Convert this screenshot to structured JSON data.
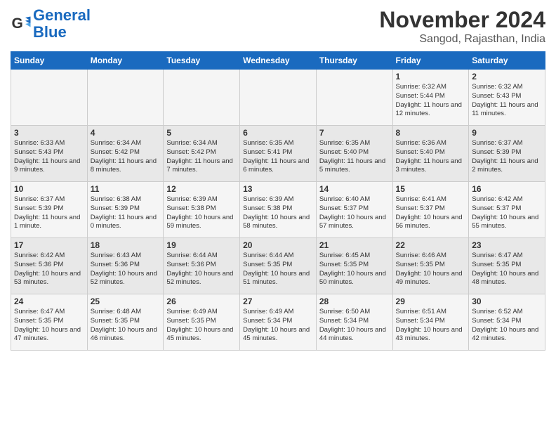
{
  "logo": {
    "line1": "General",
    "line2": "Blue"
  },
  "title": "November 2024",
  "subtitle": "Sangod, Rajasthan, India",
  "weekdays": [
    "Sunday",
    "Monday",
    "Tuesday",
    "Wednesday",
    "Thursday",
    "Friday",
    "Saturday"
  ],
  "weeks": [
    [
      {
        "day": "",
        "info": ""
      },
      {
        "day": "",
        "info": ""
      },
      {
        "day": "",
        "info": ""
      },
      {
        "day": "",
        "info": ""
      },
      {
        "day": "",
        "info": ""
      },
      {
        "day": "1",
        "info": "Sunrise: 6:32 AM\nSunset: 5:44 PM\nDaylight: 11 hours and 12 minutes."
      },
      {
        "day": "2",
        "info": "Sunrise: 6:32 AM\nSunset: 5:43 PM\nDaylight: 11 hours and 11 minutes."
      }
    ],
    [
      {
        "day": "3",
        "info": "Sunrise: 6:33 AM\nSunset: 5:43 PM\nDaylight: 11 hours and 9 minutes."
      },
      {
        "day": "4",
        "info": "Sunrise: 6:34 AM\nSunset: 5:42 PM\nDaylight: 11 hours and 8 minutes."
      },
      {
        "day": "5",
        "info": "Sunrise: 6:34 AM\nSunset: 5:42 PM\nDaylight: 11 hours and 7 minutes."
      },
      {
        "day": "6",
        "info": "Sunrise: 6:35 AM\nSunset: 5:41 PM\nDaylight: 11 hours and 6 minutes."
      },
      {
        "day": "7",
        "info": "Sunrise: 6:35 AM\nSunset: 5:40 PM\nDaylight: 11 hours and 5 minutes."
      },
      {
        "day": "8",
        "info": "Sunrise: 6:36 AM\nSunset: 5:40 PM\nDaylight: 11 hours and 3 minutes."
      },
      {
        "day": "9",
        "info": "Sunrise: 6:37 AM\nSunset: 5:39 PM\nDaylight: 11 hours and 2 minutes."
      }
    ],
    [
      {
        "day": "10",
        "info": "Sunrise: 6:37 AM\nSunset: 5:39 PM\nDaylight: 11 hours and 1 minute."
      },
      {
        "day": "11",
        "info": "Sunrise: 6:38 AM\nSunset: 5:39 PM\nDaylight: 11 hours and 0 minutes."
      },
      {
        "day": "12",
        "info": "Sunrise: 6:39 AM\nSunset: 5:38 PM\nDaylight: 10 hours and 59 minutes."
      },
      {
        "day": "13",
        "info": "Sunrise: 6:39 AM\nSunset: 5:38 PM\nDaylight: 10 hours and 58 minutes."
      },
      {
        "day": "14",
        "info": "Sunrise: 6:40 AM\nSunset: 5:37 PM\nDaylight: 10 hours and 57 minutes."
      },
      {
        "day": "15",
        "info": "Sunrise: 6:41 AM\nSunset: 5:37 PM\nDaylight: 10 hours and 56 minutes."
      },
      {
        "day": "16",
        "info": "Sunrise: 6:42 AM\nSunset: 5:37 PM\nDaylight: 10 hours and 55 minutes."
      }
    ],
    [
      {
        "day": "17",
        "info": "Sunrise: 6:42 AM\nSunset: 5:36 PM\nDaylight: 10 hours and 53 minutes."
      },
      {
        "day": "18",
        "info": "Sunrise: 6:43 AM\nSunset: 5:36 PM\nDaylight: 10 hours and 52 minutes."
      },
      {
        "day": "19",
        "info": "Sunrise: 6:44 AM\nSunset: 5:36 PM\nDaylight: 10 hours and 52 minutes."
      },
      {
        "day": "20",
        "info": "Sunrise: 6:44 AM\nSunset: 5:35 PM\nDaylight: 10 hours and 51 minutes."
      },
      {
        "day": "21",
        "info": "Sunrise: 6:45 AM\nSunset: 5:35 PM\nDaylight: 10 hours and 50 minutes."
      },
      {
        "day": "22",
        "info": "Sunrise: 6:46 AM\nSunset: 5:35 PM\nDaylight: 10 hours and 49 minutes."
      },
      {
        "day": "23",
        "info": "Sunrise: 6:47 AM\nSunset: 5:35 PM\nDaylight: 10 hours and 48 minutes."
      }
    ],
    [
      {
        "day": "24",
        "info": "Sunrise: 6:47 AM\nSunset: 5:35 PM\nDaylight: 10 hours and 47 minutes."
      },
      {
        "day": "25",
        "info": "Sunrise: 6:48 AM\nSunset: 5:35 PM\nDaylight: 10 hours and 46 minutes."
      },
      {
        "day": "26",
        "info": "Sunrise: 6:49 AM\nSunset: 5:35 PM\nDaylight: 10 hours and 45 minutes."
      },
      {
        "day": "27",
        "info": "Sunrise: 6:49 AM\nSunset: 5:34 PM\nDaylight: 10 hours and 45 minutes."
      },
      {
        "day": "28",
        "info": "Sunrise: 6:50 AM\nSunset: 5:34 PM\nDaylight: 10 hours and 44 minutes."
      },
      {
        "day": "29",
        "info": "Sunrise: 6:51 AM\nSunset: 5:34 PM\nDaylight: 10 hours and 43 minutes."
      },
      {
        "day": "30",
        "info": "Sunrise: 6:52 AM\nSunset: 5:34 PM\nDaylight: 10 hours and 42 minutes."
      }
    ]
  ]
}
